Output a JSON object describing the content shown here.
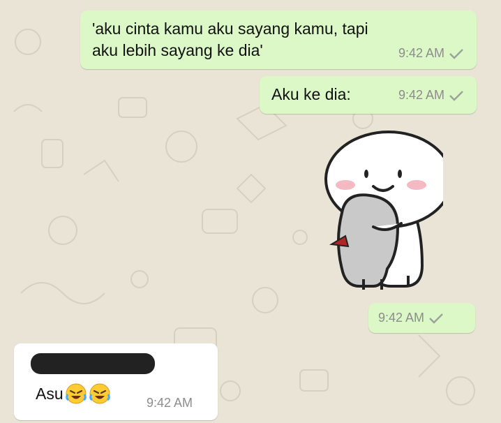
{
  "colors": {
    "outgoing_bubble": "#dcf8c6",
    "incoming_bubble": "#ffffff",
    "wallpaper": "#e9e4d6",
    "timestamp": "#8c8c8c",
    "sent_tick": "#9aa39a"
  },
  "messages": [
    {
      "direction": "outgoing",
      "lines": [
        "'aku cinta kamu aku sayang kamu, tapi",
        "aku lebih sayang ke dia'"
      ],
      "time": "9:42 AM",
      "status": "sent-check-icon"
    },
    {
      "direction": "outgoing",
      "text": "Aku ke dia:",
      "time": "9:42 AM",
      "status": "sent-check-icon"
    },
    {
      "direction": "outgoing",
      "type": "sticker",
      "sticker": "hug-sticker",
      "time": "9:42 AM",
      "status": "sent-check-icon"
    },
    {
      "direction": "incoming",
      "sender_redacted": true,
      "text": "Asu",
      "emojis": [
        "rolling-on-floor-laughing-emoji",
        "rolling-on-floor-laughing-emoji"
      ],
      "time": "9:42 AM"
    }
  ]
}
